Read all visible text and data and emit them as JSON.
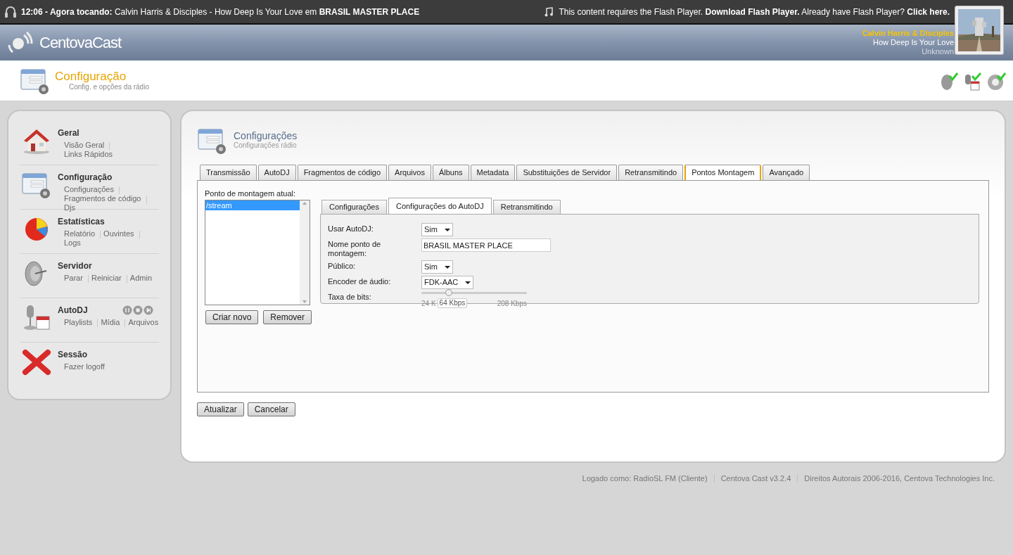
{
  "top_bar": {
    "now_playing": "**12:06 - Agora tocando:** Calvin Harris & Disciples - How Deep Is Your Love em **BRASIL MASTER PLACE**",
    "flash_notice": "This content requires the Flash Player. **Download Flash Player.** Already have Flash Player? **Click here.**"
  },
  "header": {
    "logo": "CentovaCast",
    "track": {
      "artist": "Calvin Harris & Disciples",
      "title": "How Deep Is Your Love",
      "album": "Unknown"
    }
  },
  "page_title": {
    "title": "Configuração",
    "subtitle": "Config. e opções da rádio"
  },
  "sidebar": [
    {
      "kind": "house",
      "title": "Geral",
      "links": [
        "Visão Geral",
        "Links Rápidos"
      ]
    },
    {
      "kind": "form",
      "title": "Configuração",
      "links": [
        "Configurações",
        "Fragmentos de código",
        "Djs"
      ]
    },
    {
      "kind": "chart",
      "title": "Estatísticas",
      "links": [
        "Relatório",
        "Ouvintes",
        "Logs"
      ]
    },
    {
      "kind": "dish",
      "title": "Servidor",
      "links": [
        "Parar",
        "Reiniciar",
        "Admin"
      ]
    },
    {
      "kind": "mic",
      "title": "AutoDJ",
      "links": [
        "Playlists",
        "Mídia",
        "Arquivos"
      ],
      "controls": true
    },
    {
      "kind": "cross",
      "title": "Sessão",
      "links": [
        "Fazer logoff"
      ]
    }
  ],
  "panel": {
    "title": "Configurações",
    "subtitle": "Configurações rádio",
    "tabs": [
      {
        "label": "Transmissão",
        "selected": false
      },
      {
        "label": "AutoDJ",
        "selected": false
      },
      {
        "label": "Fragmentos de código",
        "selected": false
      },
      {
        "label": "Arquivos",
        "selected": false
      },
      {
        "label": "Álbuns",
        "selected": false
      },
      {
        "label": "Metadata",
        "selected": false
      },
      {
        "label": "Substituições de Servidor",
        "selected": false
      },
      {
        "label": "Retransmitindo",
        "selected": false
      },
      {
        "label": "Pontos Montagem",
        "selected": true
      },
      {
        "label": "Avançado",
        "selected": false
      }
    ],
    "mount_list": {
      "label": "Ponto de montagem atual:",
      "items": [
        {
          "label": "/stream",
          "selected": true
        }
      ],
      "buttons": [
        "Criar novo",
        "Remover"
      ]
    },
    "sub_tabs": [
      {
        "label": "Configurações",
        "selected": false
      },
      {
        "label": "Configurações do AutoDJ",
        "selected": true
      },
      {
        "label": "Retransmitindo",
        "selected": false
      }
    ],
    "form": [
      {
        "kind": "select",
        "label": "Usar AutoDJ:",
        "value": "Sim"
      },
      {
        "kind": "text",
        "label": "Nome ponto de montagem:",
        "value": "BRASIL MASTER PLACE"
      },
      {
        "kind": "select",
        "label": "Público:",
        "value": "Sim"
      },
      {
        "kind": "select",
        "label": "Encoder de áudio:",
        "value": "FDK-AAC"
      },
      {
        "kind": "slider",
        "label": "Taxa de bits:",
        "level": 0.26,
        "min_label": "24 K",
        "tooltip": "64 Kbps",
        "max_label": "208 Kbps"
      }
    ],
    "buttons": [
      "Atualizar",
      "Cancelar"
    ]
  },
  "footer": [
    "Logado como: RadioSL FM (Cliente)",
    "Centova Cast v3.2.4",
    "Direitos Autorais 2006-2016, Centova Technologies Inc."
  ]
}
